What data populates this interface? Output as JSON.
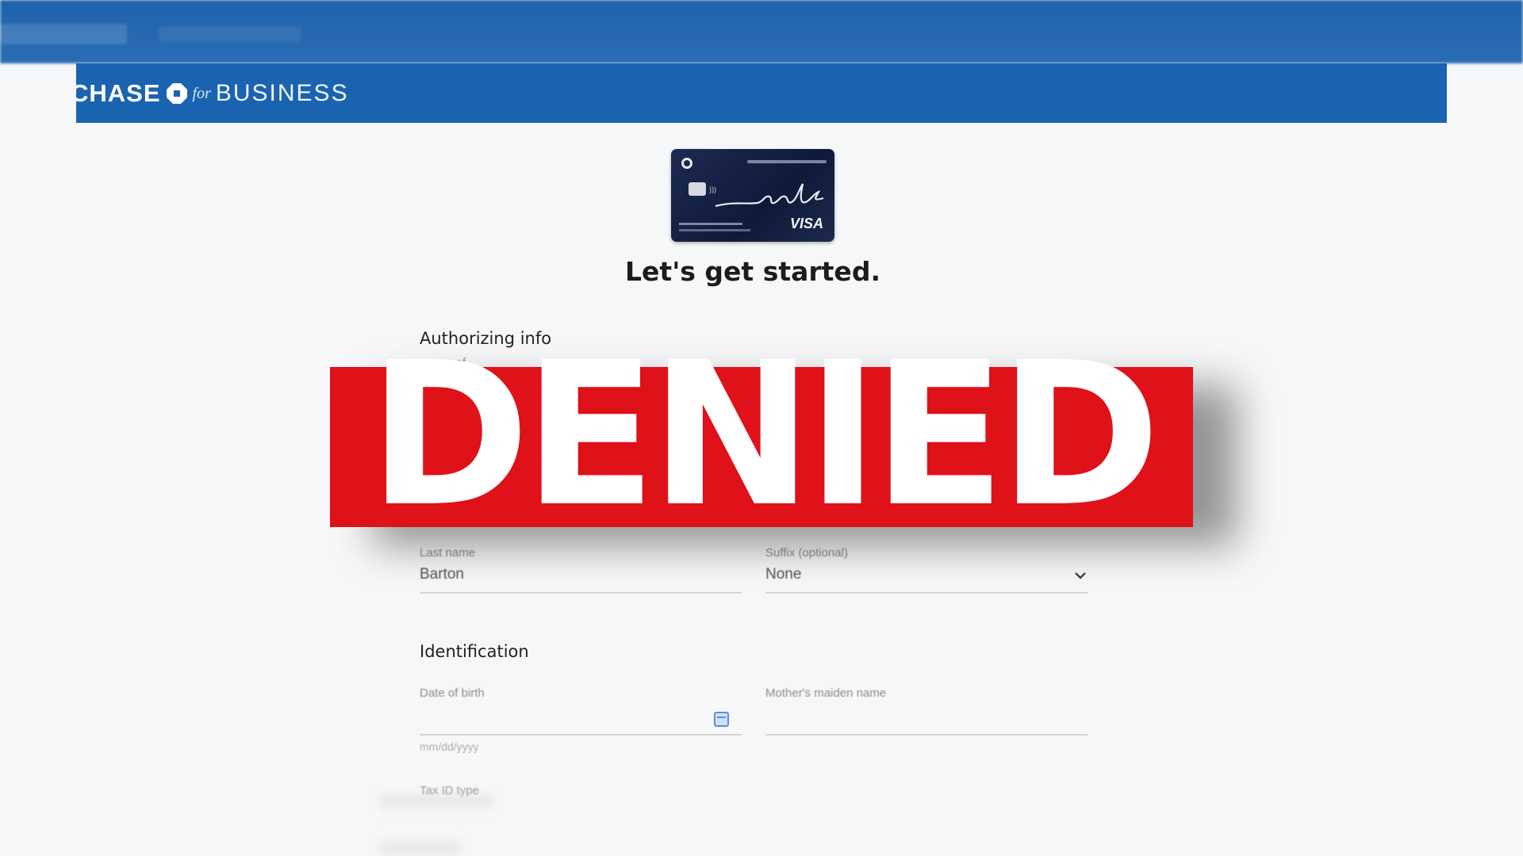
{
  "brand": {
    "name_prefix": "CHASE",
    "name_for": "for",
    "name_suffix": "BUSINESS",
    "color": "#1a63b0"
  },
  "card": {
    "network": "VISA"
  },
  "page": {
    "title": "Let's get started."
  },
  "authorizing": {
    "heading": "Authorizing info",
    "peek_text": "... as of"
  },
  "fields": {
    "last_name_label": "Last name",
    "last_name_value": "Barton",
    "suffix_label": "Suffix (optional)",
    "suffix_value": "None"
  },
  "identification": {
    "heading": "Identification",
    "dob_label": "Date of birth",
    "dob_placeholder": "mm/dd/yyyy",
    "maiden_label": "Mother's maiden name",
    "tax_id_label": "Tax ID type"
  },
  "overlay": {
    "stamp_text": "DENIED",
    "stamp_color": "#df1119"
  },
  "icons": [
    "chase-octagon-icon",
    "chevron-down-icon",
    "calendar-icon"
  ]
}
